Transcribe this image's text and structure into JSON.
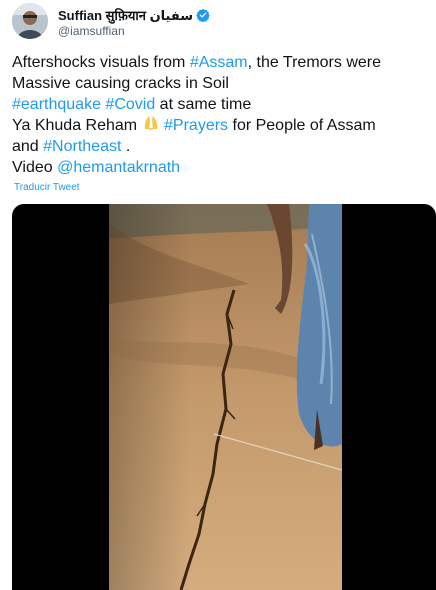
{
  "user": {
    "display_name": "Suffian सुफ़ियान سفیان",
    "handle": "@iamsuffian",
    "avatar_icon": "avatar-photo",
    "verified_icon": "verified-badge-icon"
  },
  "tweet": {
    "line1_prefix": "Aftershocks visuals from ",
    "hashtag_assam": "#Assam",
    "line1_suffix": ", the Tremors were",
    "line2": "Massive causing cracks in Soil",
    "hashtag_earthquake": "#earthquake",
    "hashtag_covid": "#Covid",
    "line3_suffix": " at same time",
    "line4_prefix": "Ya Khuda Reham ",
    "emoji_icon": "praying-hands-emoji",
    "hashtag_prayers": "#Prayers",
    "line4_suffix": " for People of Assam",
    "line5_prefix": "and ",
    "hashtag_northeast": "#Northeast",
    "line5_suffix": " .",
    "line6_prefix": "Video ",
    "mention": "@hemantakrnath"
  },
  "translate_label": "Traducir Tweet",
  "colors": {
    "link": "#1d9bf0",
    "text": "#0f1419",
    "secondary": "#536471"
  }
}
